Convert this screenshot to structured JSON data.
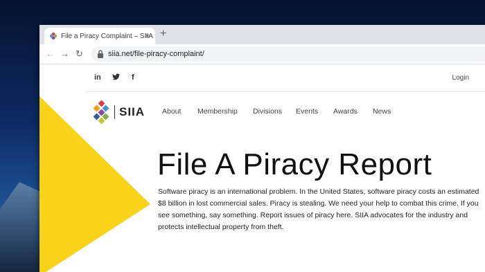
{
  "browser": {
    "tab_title": "File a Piracy Complaint – SIIA",
    "tab_close": "×",
    "new_tab": "+",
    "url": "siia.net/file-piracy-complaint/"
  },
  "site": {
    "social": {
      "linkedin": "in",
      "twitter": "🐦",
      "facebook": "f"
    },
    "login": "Login",
    "logo_text": "SIIA",
    "nav": [
      "About",
      "Membership",
      "Divisions",
      "Events",
      "Awards",
      "News"
    ],
    "heading": "File A Piracy Report",
    "paragraph": "Software piracy is an international problem. In the United States, software piracy costs an estimated $8 billion in lost commercial sales. Piracy is stealing. We need your help to combat this crime. If you see something, say something. Report issues of piracy here. SIIA advocates for the industry and protects intellectual property from theft."
  },
  "colors": {
    "accent_yellow": "#f9d21a",
    "desktop_bg": "#0d2a63"
  },
  "icons": [
    "siia-favicon-icon",
    "close-icon",
    "plus-icon",
    "back-arrow-icon",
    "forward-arrow-icon",
    "reload-icon",
    "lock-icon",
    "linkedin-icon",
    "twitter-icon",
    "facebook-icon",
    "siia-logo-icon"
  ]
}
